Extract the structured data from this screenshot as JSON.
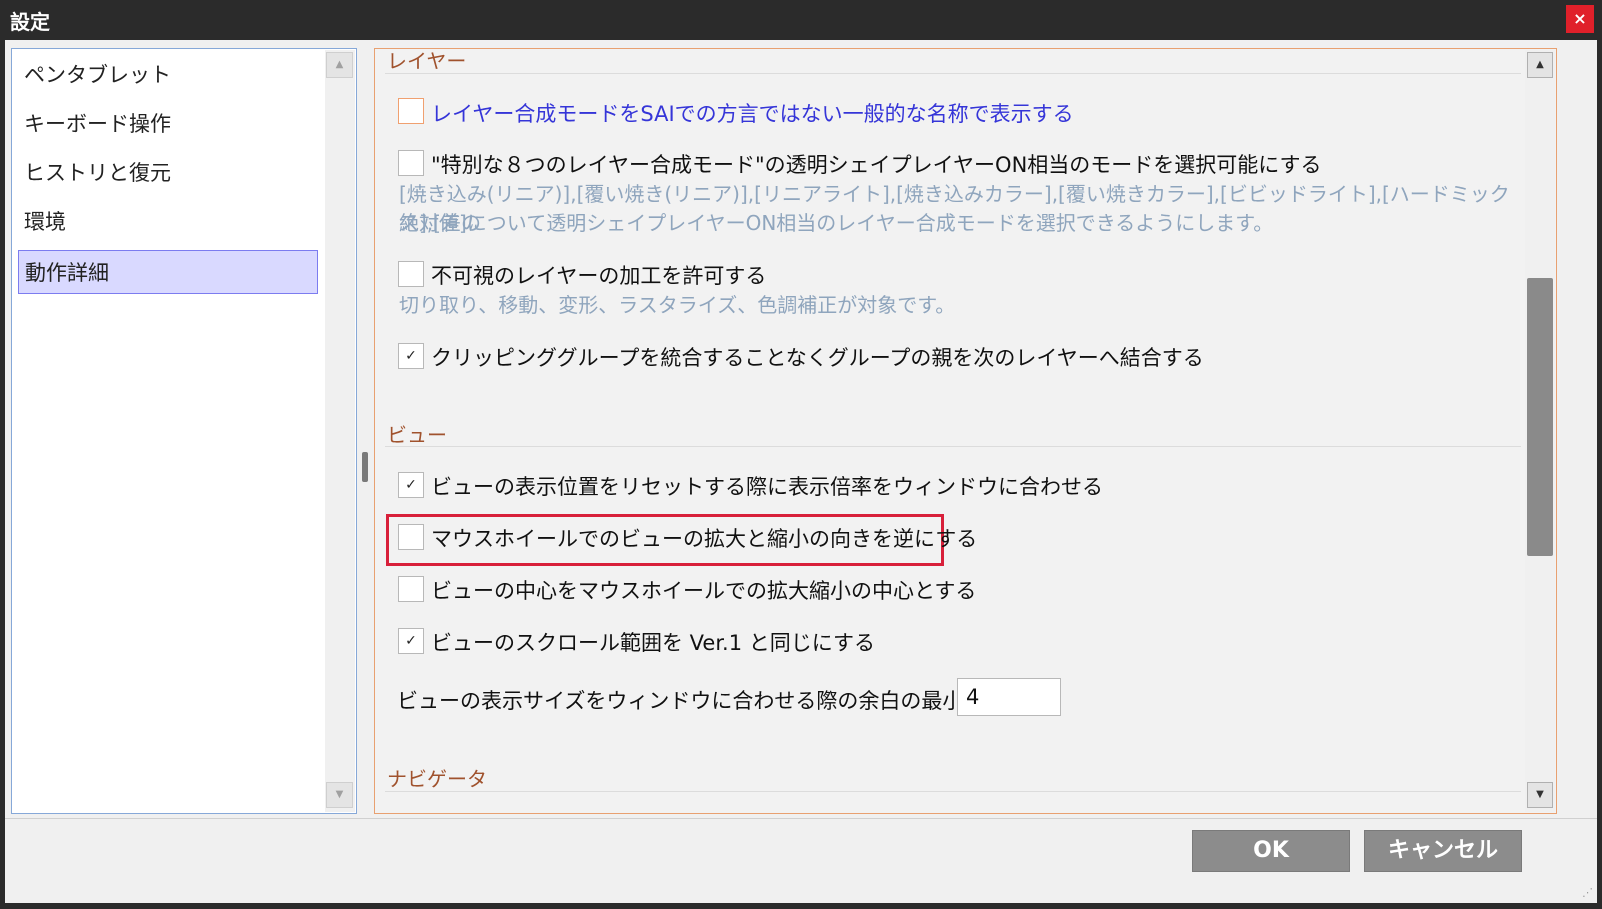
{
  "window": {
    "title": "設定",
    "close_icon": "×"
  },
  "nav": {
    "items": [
      {
        "label": "ペンタブレット",
        "selected": false
      },
      {
        "label": "キーボード操作",
        "selected": false
      },
      {
        "label": "ヒストリと復元",
        "selected": false
      },
      {
        "label": "環境",
        "selected": false
      },
      {
        "label": "動作詳細",
        "selected": true
      }
    ],
    "scroll_up": "▲",
    "scroll_down": "▼"
  },
  "panel": {
    "section_layer": "レイヤー",
    "layer_options": [
      {
        "label": "レイヤー合成モードをSAIでの方言ではない一般的な名称で表示する",
        "checked": false
      },
      {
        "label": "\"特別な８つのレイヤー合成モード\"の透明シェイプレイヤーON相当のモードを選択可能にする",
        "checked": false,
        "desc_line1": "[焼き込み(リニア)],[覆い焼き(リニア)],[リニアライト],[焼き込みカラー],[覆い焼きカラー],[ビビッドライト],[ハードミックス],[差の",
        "desc_line2": "絶対値]について透明シェイプレイヤーON相当のレイヤー合成モードを選択できるようにします。"
      },
      {
        "label": "不可視のレイヤーの加工を許可する",
        "checked": false,
        "desc": "切り取り、移動、変形、ラスタライズ、色調補正が対象です。"
      },
      {
        "label": "クリッピンググループを統合することなくグループの親を次のレイヤーへ結合する",
        "checked": true
      }
    ],
    "section_view": "ビュー",
    "view_options": [
      {
        "label": "ビューの表示位置をリセットする際に表示倍率をウィンドウに合わせる",
        "checked": true
      },
      {
        "label": "マウスホイールでのビューの拡大と縮小の向きを逆にする",
        "checked": false
      },
      {
        "label": "ビューの中心をマウスホイールでの拡大縮小の中心とする",
        "checked": false
      },
      {
        "label": "ビューのスクロール範囲を Ver.1 と同じにする",
        "checked": true
      }
    ],
    "margin_label": "ビューの表示サイズをウィンドウに合わせる際の余白の最小値：",
    "margin_value": "4",
    "section_navigator": "ナビゲータ",
    "check_mark": "✓",
    "scroll_up": "▲",
    "scroll_down": "▼"
  },
  "buttons": {
    "ok": "OK",
    "cancel": "キャンセル"
  },
  "colors": {
    "highlight_border": "#d8203a",
    "selected_nav_bg": "#d9d9ff",
    "section_header": "#a0522d",
    "close_bg": "#e0202a"
  }
}
